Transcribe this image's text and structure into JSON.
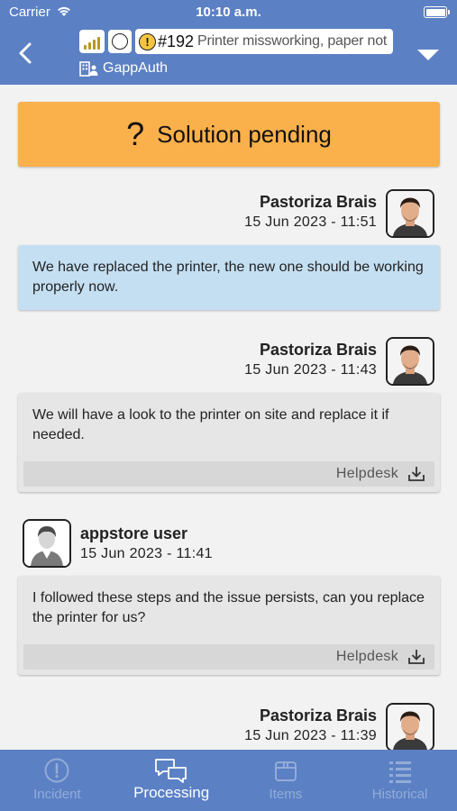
{
  "status_bar": {
    "carrier": "Carrier",
    "time": "10:10 a.m."
  },
  "header": {
    "ticket_number": "#192",
    "ticket_title": "Printer missworking, paper not",
    "organization": "GappAuth",
    "icons": [
      "back-chevron-icon",
      "signal-bars-icon",
      "empty-circle-icon",
      "exclamation-circle-icon",
      "building-icon",
      "dropdown-chevron-icon"
    ]
  },
  "banner": {
    "icon": "?",
    "text": "Solution pending",
    "color": "#fbb14b"
  },
  "messages": [
    {
      "author": "Pastoriza Brais",
      "datetime": "15 Jun 2023 - 11:51",
      "text": "We have replaced the printer, the new one should be working properly now.",
      "side": "right",
      "style": "blue"
    },
    {
      "author": "Pastoriza Brais",
      "datetime": "15 Jun 2023 - 11:43",
      "text": "We will have a look to the printer on site and replace it if needed.",
      "side": "right",
      "style": "gray",
      "attachment_label": "Helpdesk"
    },
    {
      "author": "appstore user",
      "datetime": "15 Jun 2023 - 11:41",
      "text": "I followed these steps and the issue persists, can you replace the printer for us?",
      "side": "left",
      "style": "gray",
      "attachment_label": "Helpdesk"
    },
    {
      "author": "Pastoriza Brais",
      "datetime": "15 Jun 2023 - 11:39",
      "side": "right"
    }
  ],
  "tabs": [
    {
      "label": "Incident",
      "icon": "exclamation-circle-icon",
      "active": false
    },
    {
      "label": "Processing",
      "icon": "chat-bubbles-icon",
      "active": true
    },
    {
      "label": "Items",
      "icon": "box-icon",
      "active": false
    },
    {
      "label": "Historical",
      "icon": "list-icon",
      "active": false
    }
  ],
  "colors": {
    "header": "#5b80c4",
    "banner": "#fbb14b",
    "bubble_blue": "#c5dff2",
    "bubble_gray": "#e6e6e6"
  }
}
